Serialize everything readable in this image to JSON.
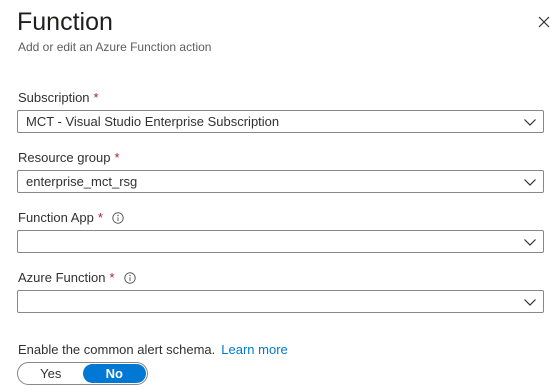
{
  "panel": {
    "title": "Function",
    "subtitle": "Add or edit an Azure Function action",
    "close_icon": "close-icon"
  },
  "fields": {
    "subscription": {
      "label": "Subscription",
      "required_mark": "*",
      "value": "MCT - Visual Studio Enterprise Subscription"
    },
    "resource_group": {
      "label": "Resource group",
      "required_mark": "*",
      "value": "enterprise_mct_rsg"
    },
    "function_app": {
      "label": "Function App",
      "required_mark": "*",
      "value": "",
      "info_icon": "info-icon"
    },
    "azure_function": {
      "label": "Azure Function",
      "required_mark": "*",
      "value": "",
      "info_icon": "info-icon"
    }
  },
  "alert_schema": {
    "label": "Enable the common alert schema.",
    "link": "Learn more",
    "options": [
      "Yes",
      "No"
    ],
    "selected": "No"
  },
  "colors": {
    "accent": "#0078d4",
    "required": "#a4262c",
    "border": "#8a8886"
  }
}
